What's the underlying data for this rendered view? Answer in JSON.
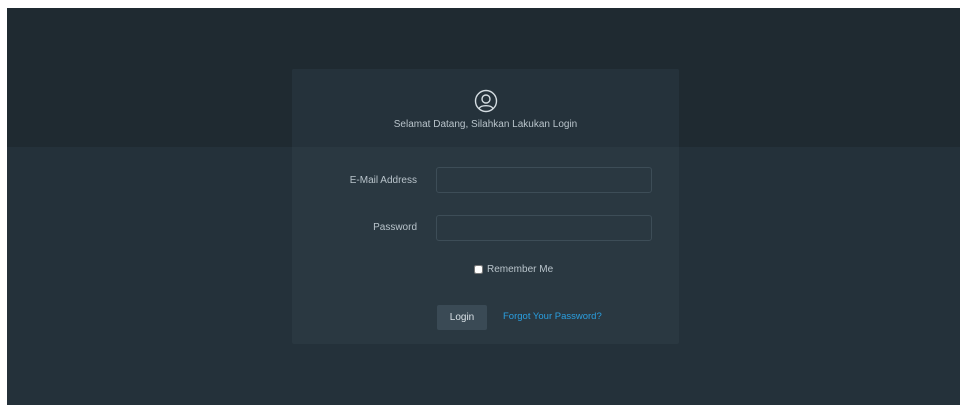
{
  "header": {
    "icon": "user-circle-icon",
    "welcome": "Selamat Datang, Silahkan Lakukan Login"
  },
  "form": {
    "email_label": "E-Mail Address",
    "email_value": "",
    "password_label": "Password",
    "password_value": "",
    "remember_label": "Remember Me",
    "remember_checked": false,
    "login_label": "Login",
    "forgot_label": "Forgot Your Password?"
  },
  "colors": {
    "background": "#24313a",
    "card": "#2a3841",
    "link": "#2a9fe0",
    "button": "#3a4a55"
  }
}
